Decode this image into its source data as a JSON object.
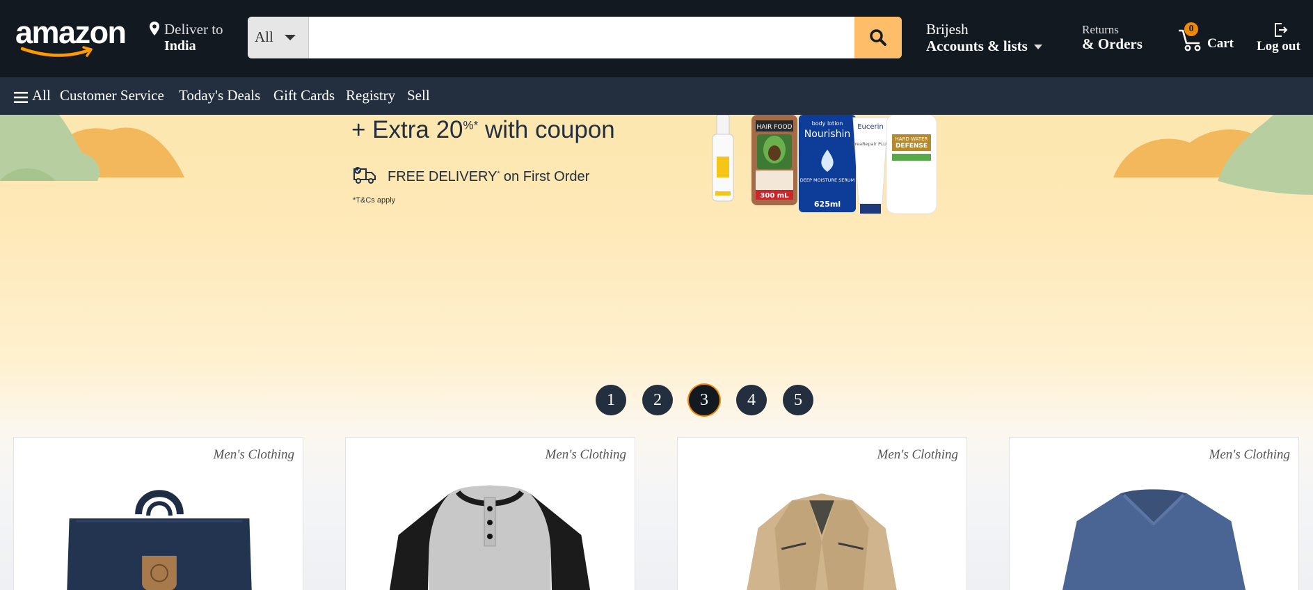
{
  "header": {
    "logo": "amazon",
    "deliver": {
      "line1": "Deliver to",
      "line2": "India"
    },
    "search": {
      "category": "All",
      "placeholder": ""
    },
    "account": {
      "greeting": "Brijesh",
      "label": "Accounts & lists"
    },
    "orders": {
      "line1": "Returns",
      "line2": "& Orders"
    },
    "cart": {
      "count": "0",
      "label": "Cart"
    },
    "logout": {
      "label": "Log out"
    }
  },
  "subnav": {
    "all": "All",
    "items": [
      "Customer Service",
      "Today's Deals",
      "Gift Cards",
      "Registry",
      "Sell"
    ]
  },
  "hero": {
    "headline": "+ Extra 20",
    "headline_sup": "%*",
    "headline_tail": " with coupon",
    "delivery": "FREE DELIVERY",
    "delivery_sup": "*",
    "delivery_tail": " on First Order",
    "terms": "*T&Cs apply",
    "product_labels": {
      "bottle_volume": "300 mL",
      "lotion_name": "Nourishin",
      "lotion_volume": "625ml",
      "lotion_top": "body lotion",
      "lotion_sub": "DEEP MOISTURE SERUM",
      "brand": "Eucerin",
      "brand_sub": "UreaRepair PLUS",
      "hair_brand": "HAIR FOOD",
      "defense1": "HARD WATER",
      "defense2": "DEFENSE"
    }
  },
  "pagination": {
    "pages": [
      "1",
      "2",
      "3",
      "4",
      "5"
    ],
    "active": "3"
  },
  "products": [
    {
      "category": "Men's Clothing",
      "image": "backpack"
    },
    {
      "category": "Men's Clothing",
      "image": "raglan-henley-shirt"
    },
    {
      "category": "Men's Clothing",
      "image": "khaki-jacket"
    },
    {
      "category": "Men's Clothing",
      "image": "blue-vneck-sweater"
    }
  ],
  "colors": {
    "nav": "#131921",
    "subnav": "#232f3e",
    "search_button": "#febd69",
    "accent": "#f08804"
  }
}
